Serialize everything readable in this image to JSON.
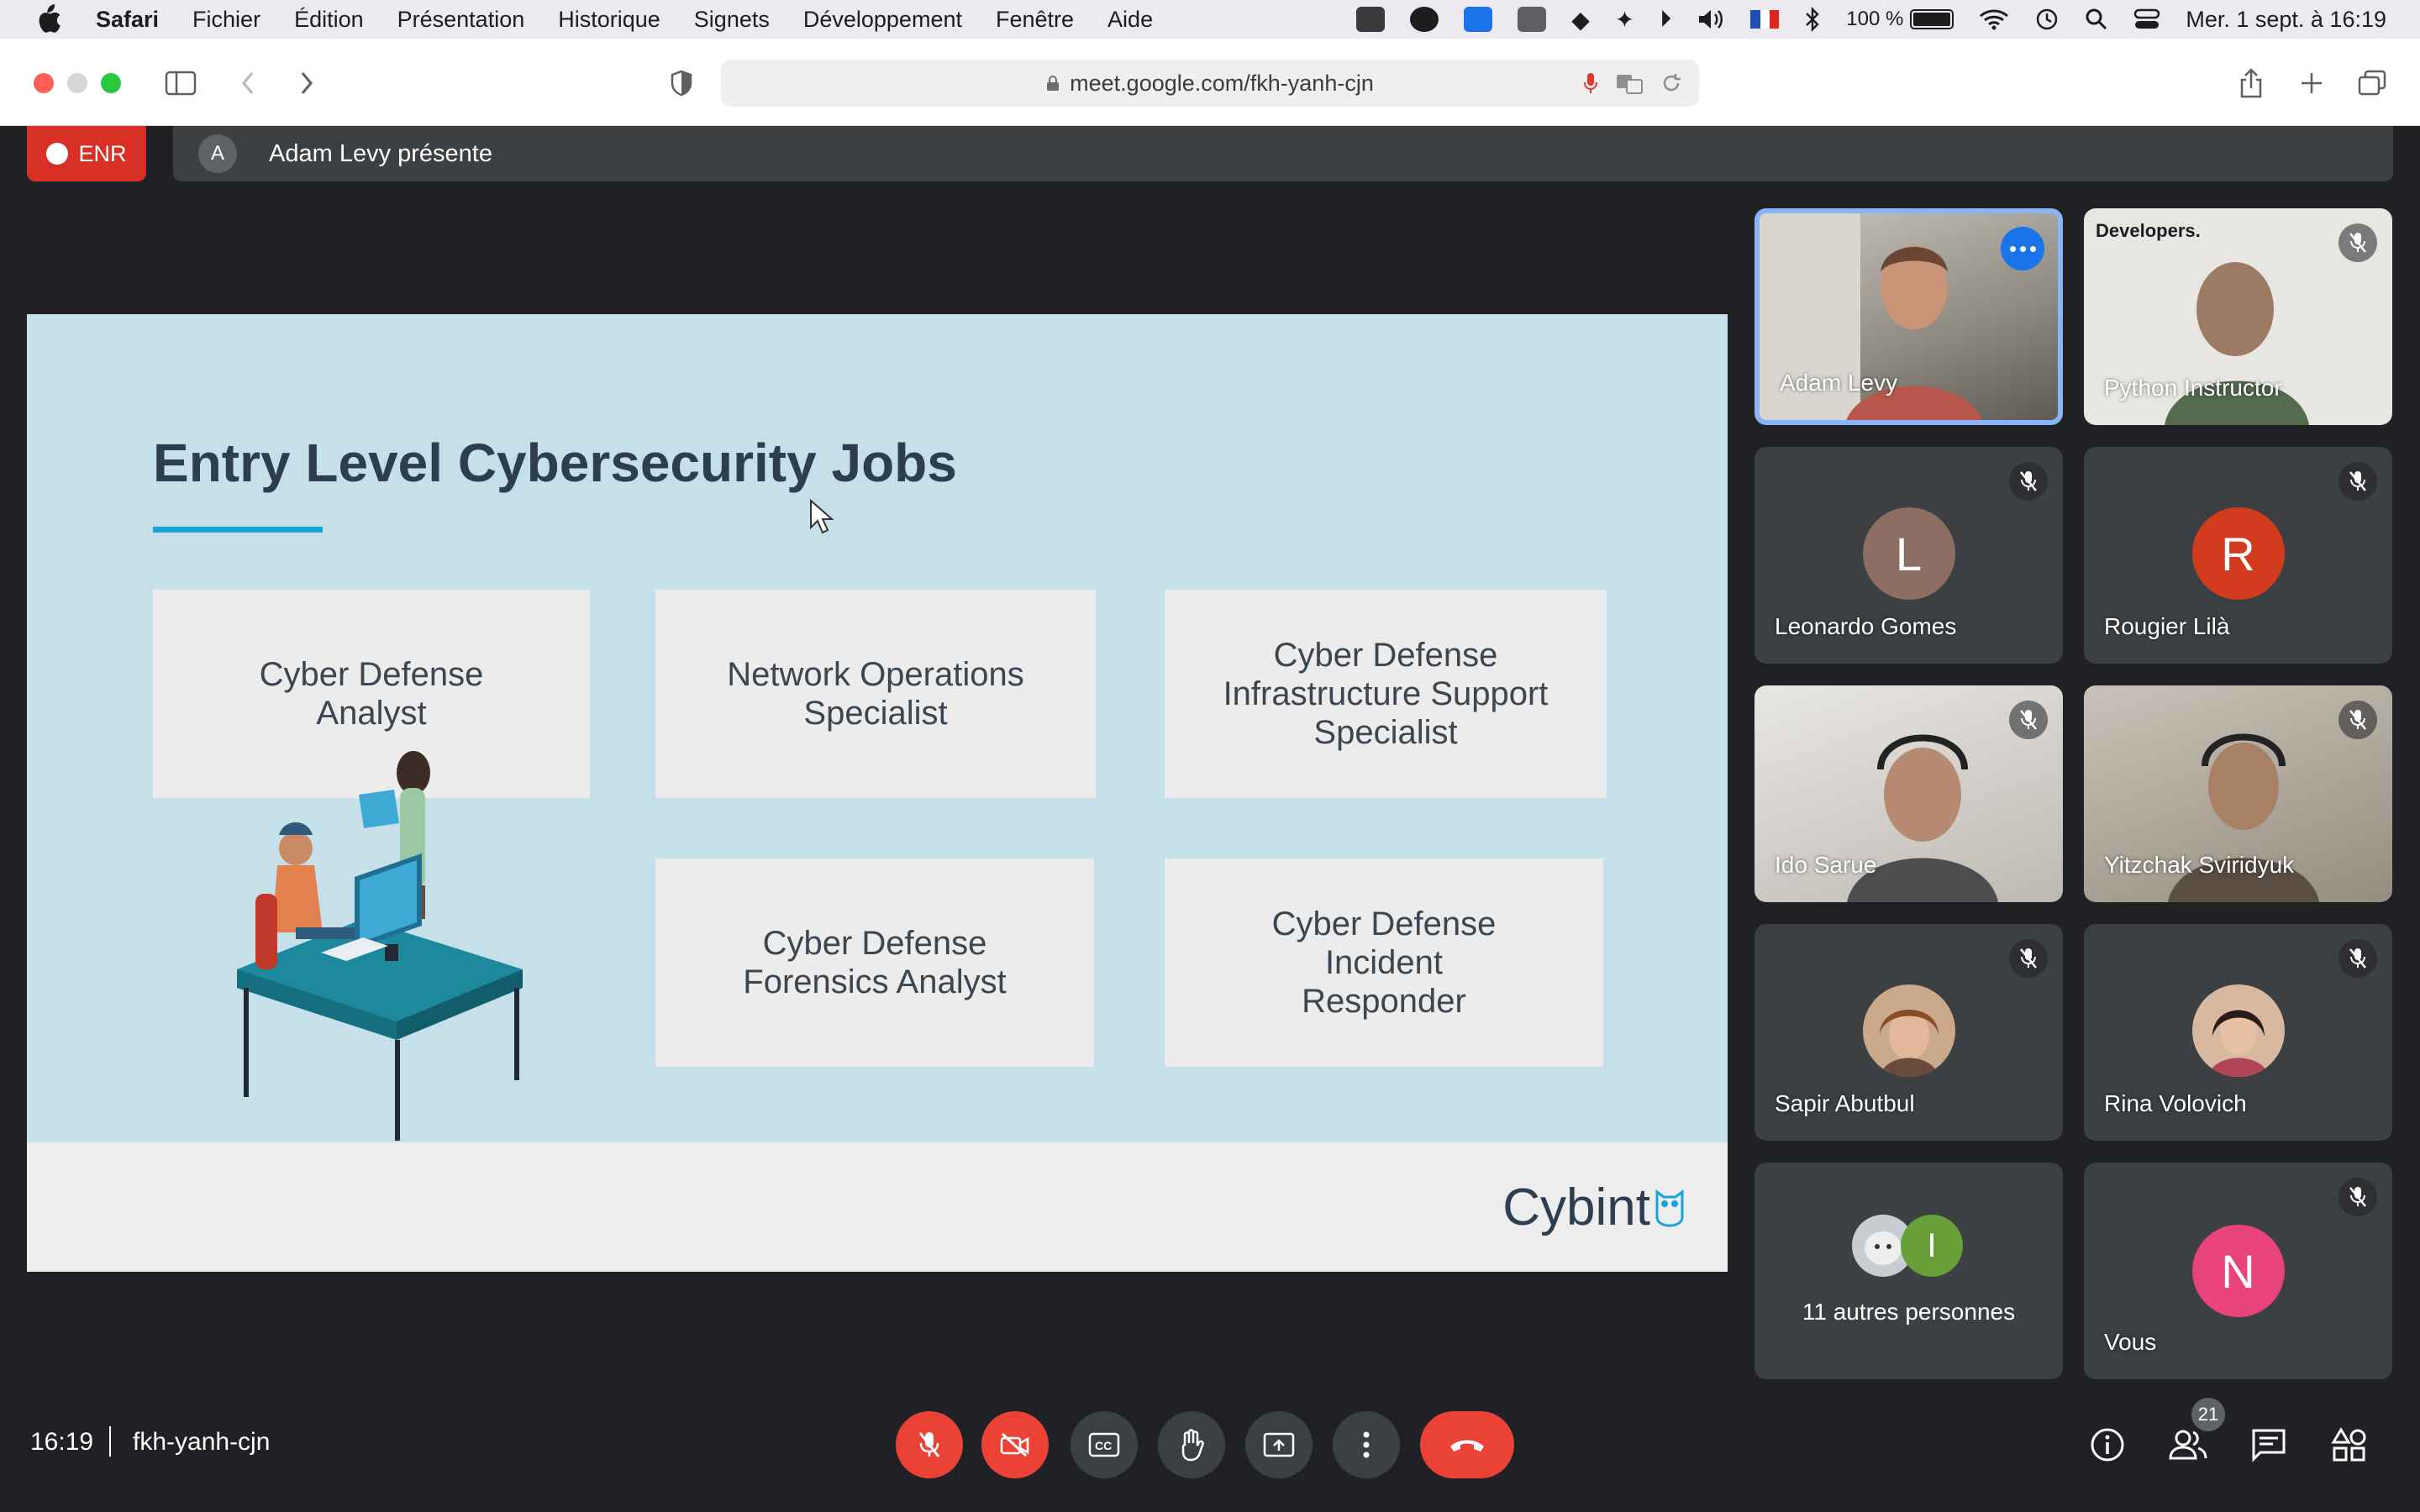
{
  "menubar": {
    "app_name": "Safari",
    "menus": [
      "Fichier",
      "Édition",
      "Présentation",
      "Historique",
      "Signets",
      "Développement",
      "Fenêtre",
      "Aide"
    ],
    "battery_percent": "100 %",
    "datetime": "Mer. 1 sept. à  16:19"
  },
  "browser": {
    "url": "meet.google.com/fkh-yanh-cjn"
  },
  "meet": {
    "recording_label": "ENR",
    "presenter_initial": "A",
    "presenting_text": "Adam Levy présente",
    "slide": {
      "title": "Entry Level Cybersecurity Jobs",
      "cards": [
        "Cyber Defense Analyst",
        "Network Operations Specialist",
        "Cyber Defense Infrastructure Support Specialist",
        "Cyber Defense Forensics Analyst",
        "Cyber Defense Incident Responder"
      ],
      "logo_text": "Cybint"
    },
    "participants": [
      {
        "name": "Adam Levy",
        "kind": "video",
        "active": true
      },
      {
        "name": "Python Instructor",
        "kind": "video",
        "muted": true,
        "overlay_text": "Developers."
      },
      {
        "name": "Leonardo Gomes",
        "kind": "initial",
        "initial": "L",
        "color": "#8d6e63",
        "muted": true
      },
      {
        "name": "Rougier Lilà",
        "kind": "initial",
        "initial": "R",
        "color": "#d33b1e",
        "muted": true
      },
      {
        "name": "Ido Sarue",
        "kind": "video",
        "muted": true
      },
      {
        "name": "Yitzchak Sviridyuk",
        "kind": "video",
        "muted": true
      },
      {
        "name": "Sapir Abutbul",
        "kind": "photo",
        "muted": true
      },
      {
        "name": "Rina Volovich",
        "kind": "photo",
        "muted": true
      },
      {
        "name": "11 autres personnes",
        "kind": "others",
        "initial": "I"
      },
      {
        "name": "Vous",
        "kind": "initial",
        "initial": "N",
        "color": "#e8437b",
        "muted": true
      }
    ],
    "clock": "16:19",
    "meeting_code": "fkh-yanh-cjn",
    "people_count": "21"
  },
  "colors": {
    "meet_bg": "#202124",
    "danger_red": "#ea4335",
    "accent_blue": "#1a73e8",
    "slide_bg": "#c5e0e9",
    "title_color": "#2c3e50"
  }
}
